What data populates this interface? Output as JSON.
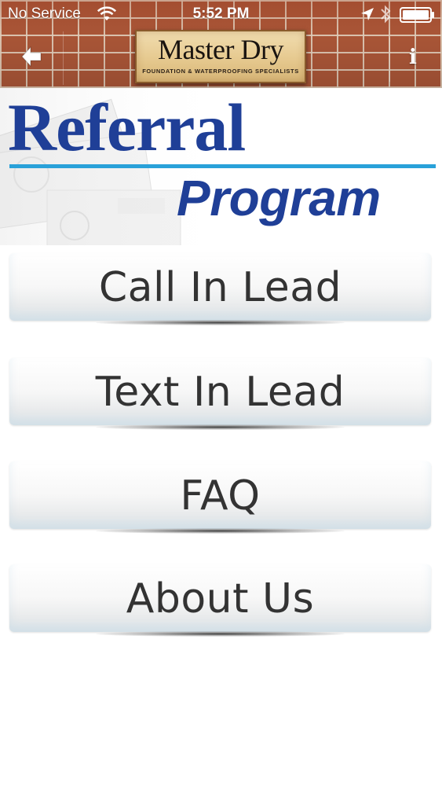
{
  "status_bar": {
    "carrier": "No Service",
    "time": "5:52 PM"
  },
  "header": {
    "logo_name": "Master Dry",
    "logo_tagline": "FOUNDATION & WATERPROOFING SPECIALISTS",
    "back_icon": "back-arrow-icon",
    "info_label": "i"
  },
  "banner": {
    "line1": "Referral",
    "line2": "Program",
    "accent_color": "#29a1d9",
    "title_color": "#1f3f97"
  },
  "menu": {
    "items": [
      {
        "label": "Call In Lead"
      },
      {
        "label": "Text In Lead"
      },
      {
        "label": "FAQ"
      },
      {
        "label": "About Us"
      }
    ]
  },
  "colors": {
    "brick": "#b25a3a",
    "button_text": "#333333"
  }
}
